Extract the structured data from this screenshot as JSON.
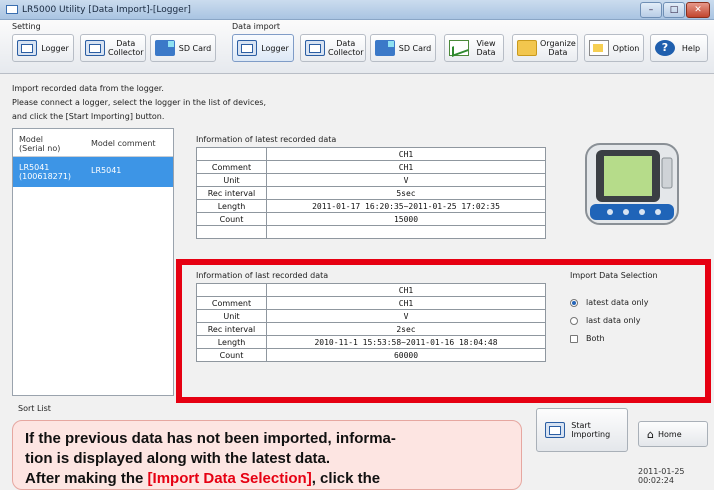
{
  "window": {
    "title": "LR5000 Utility [Data Import]-[Logger]"
  },
  "ribbon": {
    "setting_group": "Setting",
    "import_group": "Data import",
    "setting_buttons": [
      {
        "label": "Logger"
      },
      {
        "label": "Data\nCollector"
      },
      {
        "label": "SD Card"
      }
    ],
    "import_buttons": [
      {
        "label": "Logger"
      },
      {
        "label": "Data\nCollector"
      },
      {
        "label": "SD Card"
      }
    ],
    "view_data": "View\nData",
    "organize_data": "Organize\nData",
    "option": "Option",
    "help": "Help"
  },
  "instructions": {
    "line1": "Import recorded data from the logger.",
    "line2": "Please connect a logger, select the logger in the list of devices,",
    "line3": "and click the [Start Importing] button."
  },
  "device_list": {
    "col_model": "Model\n(Serial no)",
    "col_comment": "Model comment",
    "rows": [
      {
        "model": "LR5041\n(100618271)",
        "comment": "LR5041"
      }
    ]
  },
  "latest": {
    "label": "Information of latest recorded data",
    "header": "CH1",
    "rows": [
      {
        "k": "Comment",
        "v": "CH1"
      },
      {
        "k": "Unit",
        "v": "V"
      },
      {
        "k": "Rec interval",
        "v": "5sec"
      },
      {
        "k": "Length",
        "v": "2011-01-17 16:20:35~2011-01-25 17:02:35"
      },
      {
        "k": "Count",
        "v": "15000"
      }
    ]
  },
  "last": {
    "label": "Information of last recorded data",
    "header": "CH1",
    "rows": [
      {
        "k": "Comment",
        "v": "CH1"
      },
      {
        "k": "Unit",
        "v": "V"
      },
      {
        "k": "Rec interval",
        "v": "2sec"
      },
      {
        "k": "Length",
        "v": "2010-11-1 15:53:58~2011-01-16 18:04:48"
      },
      {
        "k": "Count",
        "v": "60000"
      }
    ]
  },
  "import_selection": {
    "label": "Import Data Selection",
    "options": [
      "latest data only",
      "last data only",
      "Both"
    ],
    "selected": "latest data only"
  },
  "sort_list": "Sort List",
  "start_importing": "Start Importing",
  "home": "Home",
  "datetime": "2011-01-25 00:02:24",
  "callout": {
    "line1": "If the previous data has not been imported, informa-",
    "line2": "tion is displayed along with the latest data.",
    "line3_pre": "After making the ",
    "line3_hl": "[Import Data Selection]",
    "line3_post": ", click the"
  },
  "colors": {
    "highlight_frame": "#e60012",
    "selection_row": "#3d95e6"
  }
}
